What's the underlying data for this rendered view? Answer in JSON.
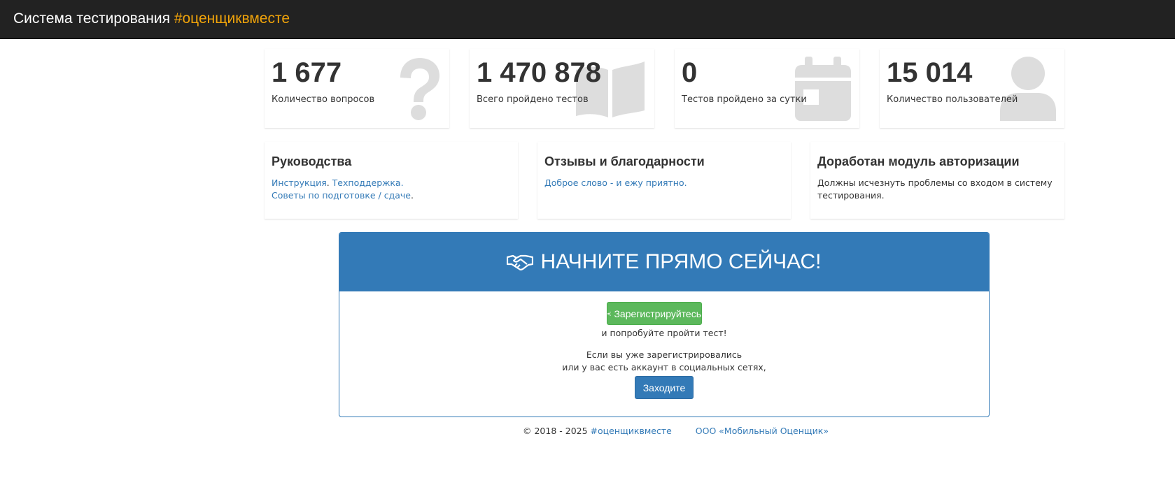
{
  "header": {
    "title": "Система тестирования",
    "hashtag": "#оценщиквместе"
  },
  "stats": [
    {
      "value": "1 677",
      "label": "Количество вопросов",
      "icon": "question-icon"
    },
    {
      "value": "1 470 878",
      "label": "Всего пройдено тестов",
      "icon": "book-open-icon"
    },
    {
      "value": "0",
      "label": "Тестов пройдено за сутки",
      "icon": "calendar-icon"
    },
    {
      "value": "15 014",
      "label": "Количество пользователей",
      "icon": "user-icon"
    }
  ],
  "info": {
    "guides": {
      "title": "Руководства",
      "link_instruction": "Инструкция",
      "link_support": "Техподдержка.",
      "link_tips": "Советы по подготовке / сдаче"
    },
    "reviews": {
      "title": "Отзывы и благодарности",
      "link": "Доброе слово - и ежу приятно."
    },
    "auth": {
      "title": "Доработан модуль авторизации",
      "text": "Должны исчезнуть проблемы со входом в систему тестирования."
    }
  },
  "cta": {
    "title": "НАЧНИТЕ ПРЯМО СЕЙЧАС!",
    "register_label": "Зарегистрируйтесь",
    "try_text": "и попробуйте пройти тест!",
    "already_line1": "Если вы уже зарегистрировались",
    "already_line2": "или у вас есть аккаунт в социальных сетях,",
    "login_label": "Заходите"
  },
  "footer": {
    "copyright": "© 2018 - 2025",
    "hashtag_link": "#оценщиквместе",
    "company_link": "ООО «Мобильный Оценщик»"
  },
  "colors": {
    "navbar": "#222222",
    "accent_orange": "#f0a30a",
    "primary": "#337ab7",
    "success": "#5cb85c",
    "icon_gray": "#dddddd"
  }
}
